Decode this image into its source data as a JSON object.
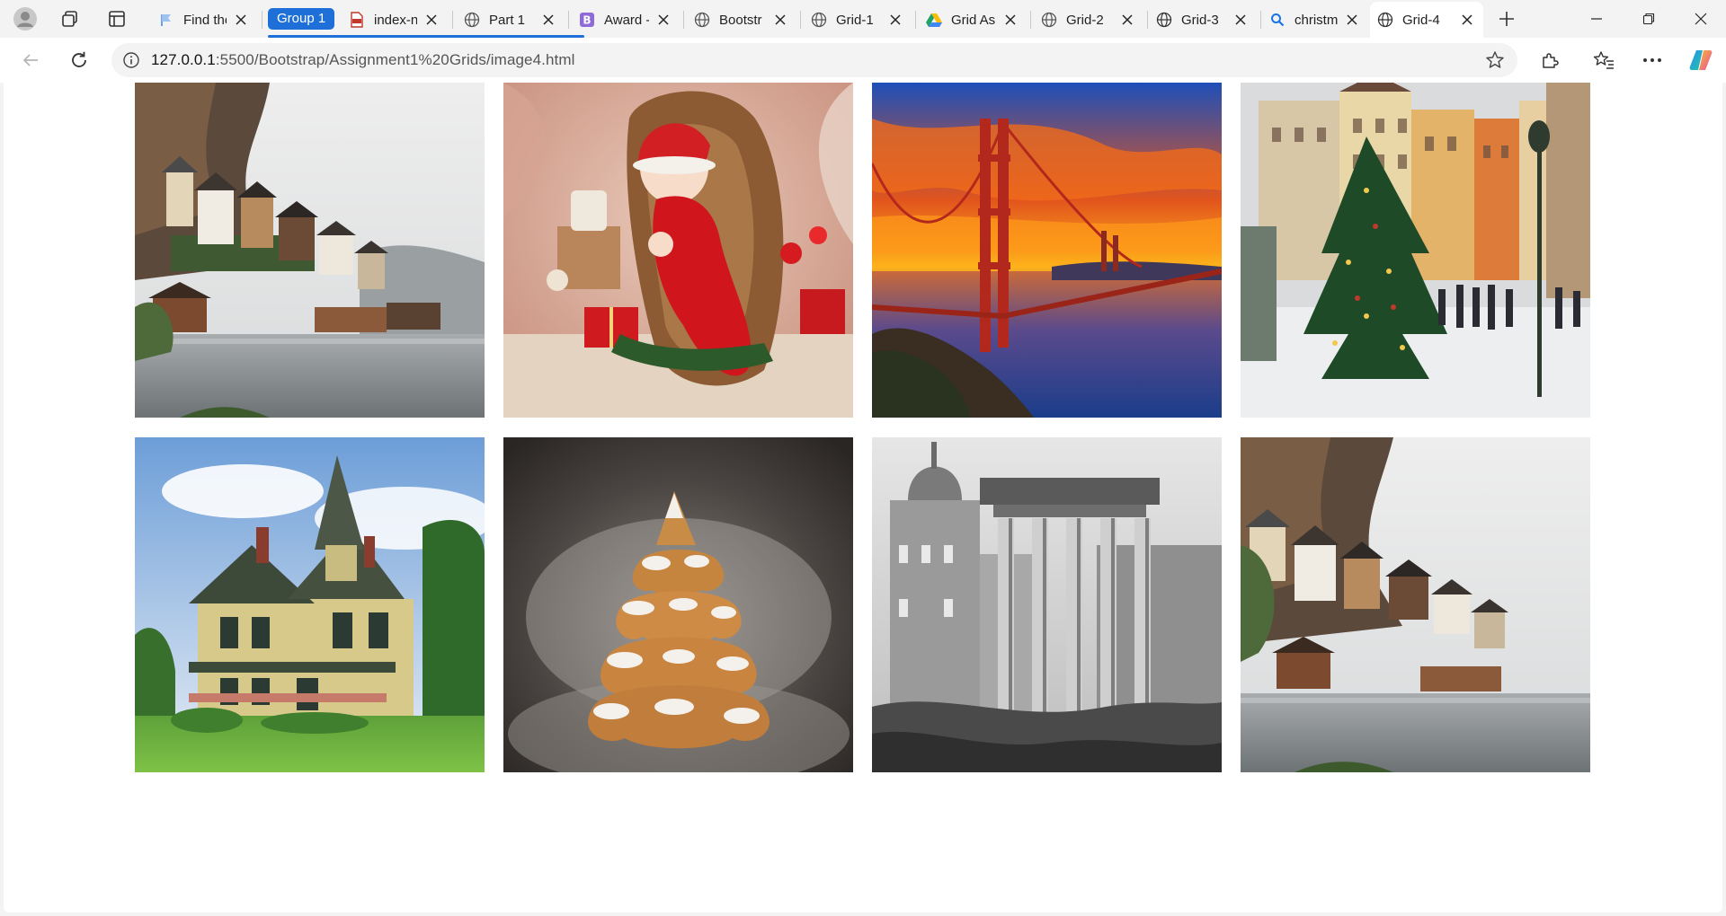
{
  "tabs": [
    {
      "title": "Find the",
      "favicon": "flag-icon"
    },
    {
      "title": "index-n",
      "favicon": "pdf-icon"
    },
    {
      "title": "Part 1",
      "favicon": "globe-icon"
    },
    {
      "title": "Award -",
      "favicon": "bootstrap-icon"
    },
    {
      "title": "Bootstr",
      "favicon": "globe-icon"
    },
    {
      "title": "Grid-1",
      "favicon": "globe-icon"
    },
    {
      "title": "Grid As",
      "favicon": "drive-icon"
    },
    {
      "title": "Grid-2",
      "favicon": "globe-icon"
    },
    {
      "title": "Grid-3",
      "favicon": "globe-icon"
    },
    {
      "title": "christm",
      "favicon": "search-icon"
    },
    {
      "title": "Grid-4",
      "favicon": "globe-icon",
      "active": true
    }
  ],
  "tab_group": {
    "label": "Group 1",
    "color": "#1f6fd8"
  },
  "address": {
    "host": "127.0.0.1",
    "path": ":5500/Bootstrap/Assignment1%20Grids/image4.html"
  },
  "gallery": {
    "images": [
      {
        "name": "lakeside-village-image"
      },
      {
        "name": "newborn-santa-image"
      },
      {
        "name": "golden-gate-sunset-image"
      },
      {
        "name": "christmas-market-square-image"
      },
      {
        "name": "victorian-house-image"
      },
      {
        "name": "gingerbread-tree-cookie-image"
      },
      {
        "name": "roman-forum-ruins-image"
      },
      {
        "name": "lakeside-village-repeat-image"
      }
    ]
  },
  "colors": {
    "tab_group": "#1f6fd8",
    "page_background": "#ffffff",
    "chrome_background": "#f3f3f3"
  }
}
